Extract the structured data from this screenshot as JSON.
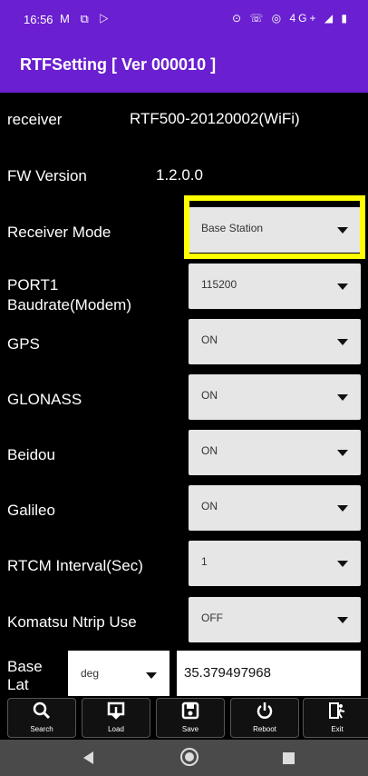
{
  "status": {
    "time": "16:56",
    "left_icons": "M ⧉ ▷",
    "right_icons": "⊙ ☏ ◎ 4G+ ◢ ▮"
  },
  "app": {
    "title": "RTFSetting [ Ver 000010 ]"
  },
  "settings": {
    "receiver": {
      "label": "receiver",
      "value": "RTF500-20120002(WiFi)"
    },
    "fw_version": {
      "label": "FW Version",
      "value": "1.2.0.0"
    },
    "receiver_mode": {
      "label": "Receiver Mode",
      "value": "Base Station"
    },
    "port1": {
      "label": "PORT1\nBaudrate(Modem)",
      "value": "115200"
    },
    "gps": {
      "label": "GPS",
      "value": "ON"
    },
    "glonass": {
      "label": "GLONASS",
      "value": "ON"
    },
    "beidou": {
      "label": "Beidou",
      "value": "ON"
    },
    "galileo": {
      "label": "Galileo",
      "value": "ON"
    },
    "rtcm_interval": {
      "label": "RTCM Interval(Sec)",
      "value": "1"
    },
    "komatsu_ntrip": {
      "label": "Komatsu Ntrip Use",
      "value": "OFF"
    },
    "base_lat": {
      "label": "Base\nLat",
      "unit": "deg",
      "value": "35.379497968"
    }
  },
  "toolbar": {
    "search": {
      "label": "Search",
      "icon": "search-icon"
    },
    "load": {
      "label": "Load",
      "icon": "download-icon"
    },
    "save": {
      "label": "Save",
      "icon": "floppy-disk-icon"
    },
    "reboot": {
      "label": "Reboot",
      "icon": "power-icon"
    },
    "exit": {
      "label": "Exit",
      "icon": "exit-door-icon"
    }
  },
  "colors": {
    "accent": "#6a1fd0",
    "highlight": "#ffff00"
  }
}
